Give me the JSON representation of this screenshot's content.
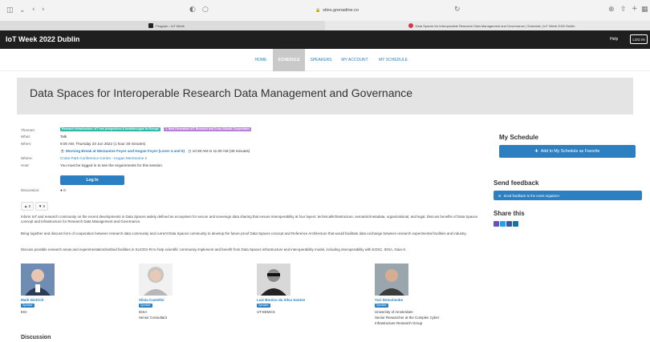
{
  "browser": {
    "address": "sites.grenadine.co",
    "tabs": [
      {
        "label": "Program - IoT Week",
        "active": false
      },
      {
        "label": "Data Spaces for Interoperable Research Data Management and Governance | Schedule | IoT Week 2022 Dublin",
        "active": true
      }
    ]
  },
  "header": {
    "site_title": "IoT Week 2022 Dublin",
    "help": "Help",
    "login": "LOG IN"
  },
  "nav": {
    "items": [
      "HOME",
      "SCHEDULE",
      "SPEAKERS",
      "MY ACCOUNT",
      "MY SCHEDULE"
    ],
    "active_index": 1
  },
  "session": {
    "title": "Data Spaces for Interoperable Research Data Management and Governance",
    "labels": {
      "themes": "Themes:",
      "what": "What:",
      "when": "When:",
      "where": "Where:",
      "host": "Host:",
      "discussion": "Discussion:"
    },
    "themes": [
      {
        "text": "Research Infrastructure: IoT new perspectives & breakthroughs for Europe",
        "color": "#2fb6a5"
      },
      {
        "text": "1. Next Generation IoT: Research and Cross Atlantic Cooperation",
        "color": "#b77fd6"
      }
    ],
    "what": "Talk",
    "when": "9:00 AM, Thursday 23 Jun 2022 (1 hour 30 minutes)",
    "break_link": "Morning Break at Mezzanine Foyer and Hogan Foyer (Lever 4 and 6)",
    "break_time": "10:30 AM to 11:00 AM (30 minutes)",
    "where": "Croke Park Conference Centre - Hogan Mezzanine 2",
    "host_note": "You must be logged in to see the requirements for this session.",
    "login_button": "Log In",
    "discussion_count": "0",
    "likes": "0",
    "dislikes": "0"
  },
  "description": [
    "Inform IoT and research community on the recent developments in Data Spaces widely defined as ecosystem for secure and sovereign data sharing that ensure interoperability at four layers: technical/infrastructure, semantic/metadata, organizational, and legal. Discuss benefits of Data Spaces concept and infrastructure for Research Data Management and Governance.",
    "Bring together and discuss form of cooperation between research data community and current Data Spaces community to develop the future-proof Data Spaces concept and Reference Architecture that would facilitate data exchange between research experimental facilities and industry.",
    "Discuss possible research areas and experimentation/testbed facilities in SLICES-RI to help scientific community implement and benefit from Data Spaces infrastructure and interoperability model, including interoperability with EOSC, IDSA, Gaia-X."
  ],
  "speakers": [
    {
      "name": "Mark Dietrich",
      "role": "Speaker",
      "lines": [
        "EGI"
      ]
    },
    {
      "name": "Silvia Castellvi",
      "role": "Speaker",
      "lines": [
        "IDSA",
        "Senior Consultant"
      ]
    },
    {
      "name": "Luiz Bonino da Silva Santos",
      "role": "Speaker",
      "lines": [
        "UT-EEMCS"
      ]
    },
    {
      "name": "Yuri Demchenko",
      "role": "Speaker",
      "lines": [
        "University of Amsterdam",
        "Senior Researcher at the Complex Cyber",
        "Infrastructure Research Group"
      ]
    }
  ],
  "discussion_heading": "Discussion",
  "sidebar": {
    "my_schedule_heading": "My Schedule",
    "add_button": "Add to My Schedule as Favorite",
    "feedback_heading": "Send feedback",
    "feedback_button": "Send feedback to the event organizer",
    "share_heading": "Share this",
    "share_icons": [
      "email-icon",
      "twitter-icon",
      "facebook-icon",
      "linkedin-icon"
    ]
  },
  "colors": {
    "accent": "#2c7fc0",
    "header_bg": "#1f1f1f",
    "title_band": "#e4e4e4"
  }
}
